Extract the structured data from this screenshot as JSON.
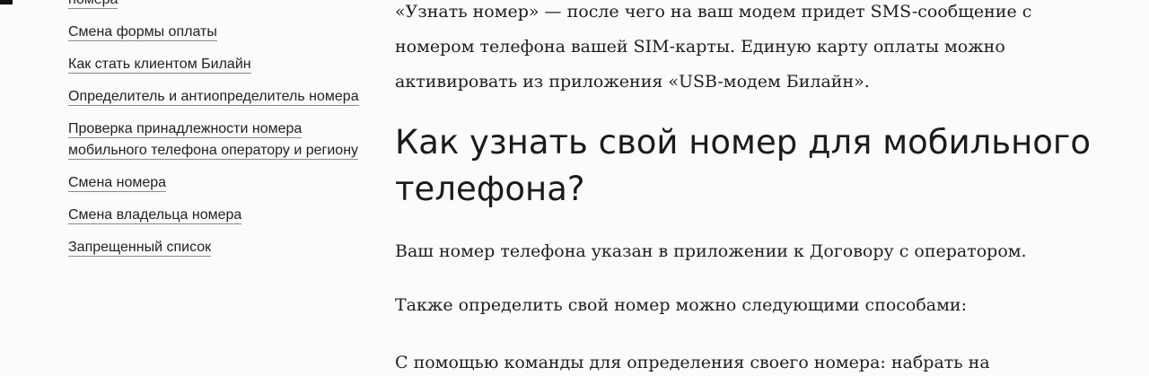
{
  "sidebar": {
    "items": [
      {
        "label": "номера"
      },
      {
        "label": "Смена формы оплаты"
      },
      {
        "label": "Как стать клиентом Билайн"
      },
      {
        "label": "Определитель и антиопределитель номера"
      },
      {
        "label": "Проверка принадлежности номера мобильного телефона оператору и региону"
      },
      {
        "label": "Смена номера"
      },
      {
        "label": "Смена владельца номера"
      },
      {
        "label": "Запрещенный список"
      }
    ]
  },
  "main": {
    "intro_line1": "«Узнать номер» — после чего на ваш модем придет SMS-сообщение с",
    "intro_line2": "номером телефона вашей SIM-карты. Единую карту оплаты можно",
    "intro_line3": "активировать из приложения «USB-модем Билайн».",
    "heading": "Как узнать свой номер для мобильного телефона?",
    "paragraph1": "Ваш номер телефона указан в приложении к Договору с оператором.",
    "paragraph2": "Также определить свой номер можно следующими способами:",
    "paragraph3": "С помощью команды для определения своего номера: набрать на"
  }
}
